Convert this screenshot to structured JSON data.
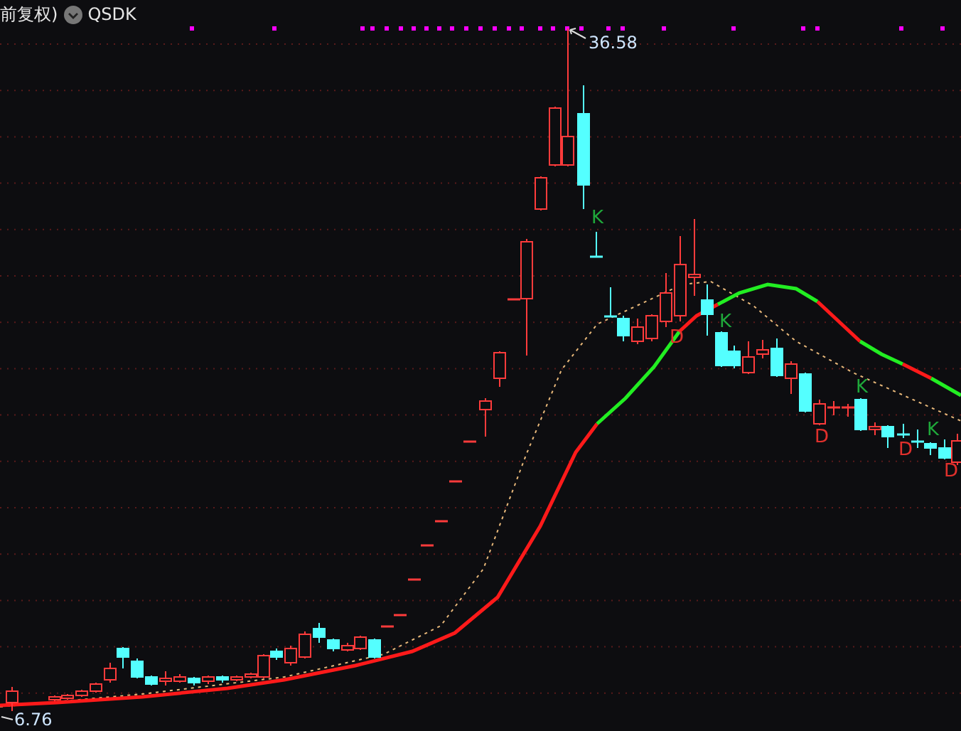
{
  "header": {
    "title": "前复权)",
    "symbol": "QSDK"
  },
  "chart": {
    "high_label": "36.58",
    "low_label": "6.76",
    "markers": [
      {
        "text": "K",
        "kind": "buy"
      },
      {
        "text": "K",
        "kind": "buy"
      },
      {
        "text": "K",
        "kind": "buy"
      },
      {
        "text": "K",
        "kind": "buy"
      },
      {
        "text": "D",
        "kind": "sell"
      },
      {
        "text": "D",
        "kind": "sell"
      },
      {
        "text": "D",
        "kind": "sell"
      },
      {
        "text": "D",
        "kind": "sell"
      }
    ]
  }
}
